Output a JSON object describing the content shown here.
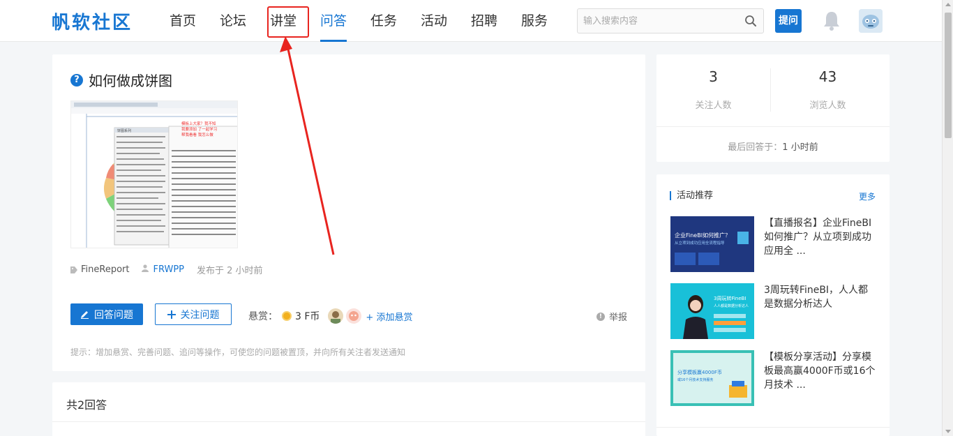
{
  "header": {
    "logo": "帆软社区",
    "nav": [
      "首页",
      "论坛",
      "讲堂",
      "问答",
      "任务",
      "活动",
      "招聘",
      "服务"
    ],
    "active_nav": "问答",
    "search_placeholder": "输入搜索内容",
    "ask_label": "提问"
  },
  "question": {
    "title": "如何做成饼图",
    "title_icon": "?",
    "tag": "FineReport",
    "author": "FRWPP",
    "time": "发布于 2 小时前",
    "answer_label": "回答问题",
    "follow_label": "关注问题",
    "reward_label": "悬赏：",
    "reward_amount": "3 F币",
    "add_reward_label": "+ 添加悬赏",
    "report_label": "举报",
    "hint": "提示：增加悬赏、完善问题、追问等操作，可使您的问题被置顶，并向所有关注者发送通知",
    "screenshot_annotation": [
      "模板上大家？我不知",
      "我要添加 了一起学习",
      "帮我看看 我怎么做"
    ],
    "screenshot_header": "饼图系列"
  },
  "answers": {
    "title": "共2回答"
  },
  "stats": {
    "followers_count": "3",
    "followers_label": "关注人数",
    "views_count": "43",
    "views_label": "浏览人数",
    "last_answer_label": "最后回答于：",
    "last_answer_value": "1 小时前"
  },
  "activities": {
    "title": "活动推荐",
    "more_label": "更多",
    "items": [
      {
        "text": "【直播报名】企业FineBI如何推广？从立项到成功应用全 ...",
        "thumb_title": "企业FineBI如何推广？",
        "thumb_sub": "从立项到成功应用全流程指导",
        "thumb_bg": "#1a2f6e"
      },
      {
        "text": "3周玩转FineBI，人人都是数据分析达人",
        "thumb_title": "3周玩转FineBI",
        "thumb_sub": "人人都是数据分析达人",
        "thumb_bg": "#19c0d8"
      },
      {
        "text": "【模板分享活动】分享模板最高赢4000F币或16个月技术 ...",
        "thumb_title": "分享模板赢4000F币",
        "thumb_sub": "或16个月技术支持服务",
        "thumb_bg": "#d7f2ef"
      }
    ]
  },
  "colors": {
    "accent": "#1776d2",
    "annotation_box": "#e8241f"
  }
}
